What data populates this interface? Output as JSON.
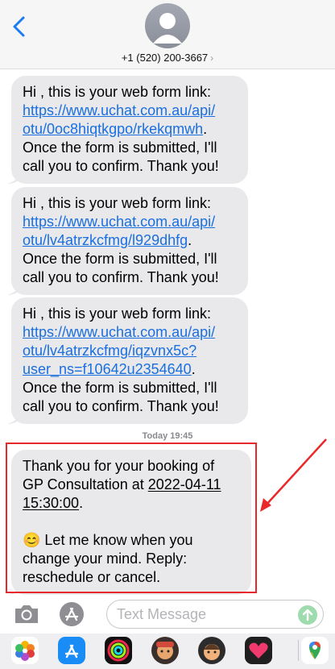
{
  "header": {
    "phone": "+1 (520) 200-3667",
    "chevron": "›"
  },
  "messages": [
    {
      "intro": "Hi , this is your web form link:",
      "link_lines": [
        "https://www.uchat.com.au/api/",
        "otu/0oc8hiqtkgpo/rkekqmwh"
      ],
      "link_end": ".",
      "outro_lines": [
        "Once the form is submitted, I'll",
        "call you to confirm. Thank you!"
      ]
    },
    {
      "intro": "Hi , this is your web form link:",
      "link_lines": [
        "https://www.uchat.com.au/api/",
        "otu/lv4atrzkcfmg/l929dhfg"
      ],
      "link_end": ".",
      "outro_lines": [
        "Once the form is submitted, I'll",
        "call you to confirm. Thank you!"
      ]
    },
    {
      "intro": "Hi , this is your web form link:",
      "link_lines": [
        "https://www.uchat.com.au/api/",
        "otu/lv4atrzkcfmg/iqzvnx5c?",
        "user_ns=f10642u2354640"
      ],
      "link_end": ".",
      "outro_lines": [
        "Once the form is submitted, I'll",
        "call you to confirm. Thank you!"
      ]
    }
  ],
  "timestamp": "Today 19:45",
  "booking": {
    "line1": "Thank you for your booking of",
    "line2_prefix": "GP Consultation at ",
    "date": "2022-04-11",
    "time": "15:30:00",
    "time_suffix": ".",
    "emoji": "😊",
    "line4": " Let me know when you",
    "line5": "change your mind. Reply:",
    "line6": "reschedule or cancel."
  },
  "composer": {
    "placeholder": "Text Message"
  },
  "colors": {
    "link": "#1a6fe0",
    "bubble": "#e9e9eb",
    "highlight": "#e8282b",
    "send": "#9edbad"
  },
  "icons": [
    "back-chevron-icon",
    "contact-avatar-icon",
    "camera-icon",
    "app-store-icon",
    "send-arrow-icon",
    "photos-app-icon",
    "app-store-app-icon",
    "activity-app-icon",
    "memoji-app-icon",
    "memoji-app-icon",
    "digital-touch-app-icon",
    "maps-app-icon"
  ]
}
